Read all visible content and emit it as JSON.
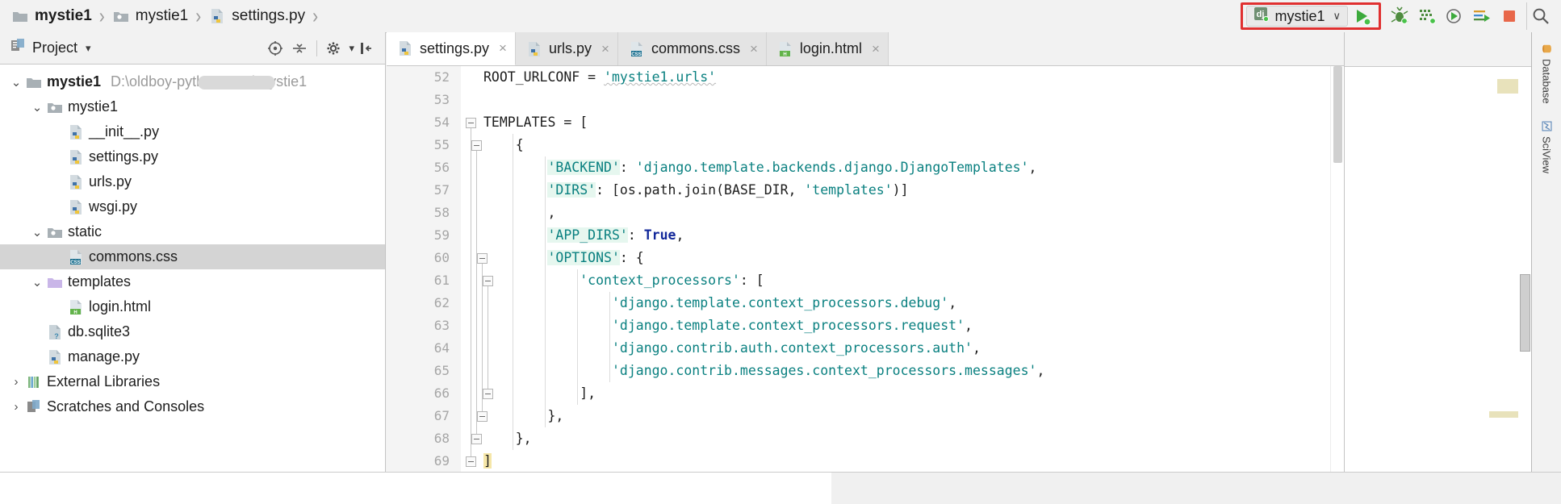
{
  "breadcrumb": {
    "items": [
      {
        "label": "mystie1",
        "icon": "folder-icon",
        "bold": true
      },
      {
        "label": "mystie1",
        "icon": "module-folder-icon",
        "bold": false
      },
      {
        "label": "settings.py",
        "icon": "python-file-icon",
        "bold": false
      }
    ],
    "separator": "›"
  },
  "toolbar": {
    "run_config": {
      "name": "mystie1",
      "icon": "django-icon",
      "chevron": "∨",
      "highlighted": true,
      "highlight_color": "#e03030"
    },
    "buttons": [
      {
        "name": "run-button",
        "icon": "run-icon",
        "color": "#3caa3c"
      },
      {
        "name": "debug-button",
        "icon": "bug-icon",
        "color": "#3f8b3f"
      },
      {
        "name": "coverage-button",
        "icon": "coverage-icon",
        "color": "#3f8b3f"
      },
      {
        "name": "profile-button",
        "icon": "profile-icon",
        "color": "#5a5a5a"
      },
      {
        "name": "run-with-console-button",
        "icon": "console-run-icon",
        "color": "#d89a2a"
      },
      {
        "name": "stop-button",
        "icon": "stop-icon",
        "color": "#e8674a"
      },
      {
        "name": "search-button",
        "icon": "search-icon",
        "color": "#5a5a5a"
      }
    ]
  },
  "project_panel": {
    "title": "Project",
    "chevron": "▾",
    "icon": "project-icon",
    "header_buttons": [
      {
        "name": "locate-button",
        "icon": "target-icon"
      },
      {
        "name": "collapse-all-button",
        "icon": "collapse-all-icon"
      },
      {
        "name": "settings-button",
        "icon": "gear-icon"
      },
      {
        "name": "hide-button",
        "icon": "hide-panel-icon"
      }
    ],
    "tree": [
      {
        "label": "mystie1",
        "path": "D:\\oldboy-python-s          00\\mystie1",
        "icon": "folder-icon",
        "indent": 0,
        "arrow": "⌄",
        "bold": true,
        "selected": false,
        "redacted": true
      },
      {
        "label": "mystie1",
        "path": "",
        "icon": "module-folder-icon",
        "indent": 1,
        "arrow": "⌄",
        "bold": false,
        "selected": false,
        "redacted": false
      },
      {
        "label": "__init__.py",
        "path": "",
        "icon": "python-file-icon",
        "indent": 2,
        "arrow": "",
        "bold": false,
        "selected": false,
        "redacted": false
      },
      {
        "label": "settings.py",
        "path": "",
        "icon": "python-file-icon",
        "indent": 2,
        "arrow": "",
        "bold": false,
        "selected": false,
        "redacted": false
      },
      {
        "label": "urls.py",
        "path": "",
        "icon": "python-file-icon",
        "indent": 2,
        "arrow": "",
        "bold": false,
        "selected": false,
        "redacted": false
      },
      {
        "label": "wsgi.py",
        "path": "",
        "icon": "python-file-icon",
        "indent": 2,
        "arrow": "",
        "bold": false,
        "selected": false,
        "redacted": false
      },
      {
        "label": "static",
        "path": "",
        "icon": "module-folder-icon",
        "indent": 1,
        "arrow": "⌄",
        "bold": false,
        "selected": false,
        "redacted": false
      },
      {
        "label": "commons.css",
        "path": "",
        "icon": "css-file-icon",
        "indent": 2,
        "arrow": "",
        "bold": false,
        "selected": true,
        "redacted": false
      },
      {
        "label": "templates",
        "path": "",
        "icon": "templates-folder-icon",
        "indent": 1,
        "arrow": "⌄",
        "bold": false,
        "selected": false,
        "redacted": false
      },
      {
        "label": "login.html",
        "path": "",
        "icon": "html-file-icon",
        "indent": 2,
        "arrow": "",
        "bold": false,
        "selected": false,
        "redacted": false
      },
      {
        "label": "db.sqlite3",
        "path": "",
        "icon": "unknown-file-icon",
        "indent": 1,
        "arrow": "",
        "bold": false,
        "selected": false,
        "redacted": false
      },
      {
        "label": "manage.py",
        "path": "",
        "icon": "python-file-icon",
        "indent": 1,
        "arrow": "",
        "bold": false,
        "selected": false,
        "redacted": false
      },
      {
        "label": "External Libraries",
        "path": "",
        "icon": "libraries-icon",
        "indent": 0,
        "arrow": "›",
        "bold": false,
        "selected": false,
        "redacted": false
      },
      {
        "label": "Scratches and Consoles",
        "path": "",
        "icon": "scratches-icon",
        "indent": 0,
        "arrow": "›",
        "bold": false,
        "selected": false,
        "redacted": false
      }
    ]
  },
  "editor": {
    "tabs": [
      {
        "label": "settings.py",
        "icon": "python-file-icon",
        "active": true,
        "close": "×"
      },
      {
        "label": "urls.py",
        "icon": "python-file-icon",
        "active": false,
        "close": "×"
      },
      {
        "label": "commons.css",
        "icon": "css-file-icon",
        "active": false,
        "close": "×"
      },
      {
        "label": "login.html",
        "icon": "html-file-icon",
        "active": false,
        "close": "×"
      }
    ],
    "first_line_number": 52,
    "lines": [
      {
        "n": 52,
        "indent": 0,
        "fold": false,
        "tokens": [
          {
            "t": "ROOT_URLCONF = ",
            "c": "plain"
          },
          {
            "t": "'mystie1.urls'",
            "c": "str spell"
          }
        ]
      },
      {
        "n": 53,
        "indent": 0,
        "fold": false,
        "tokens": []
      },
      {
        "n": 54,
        "indent": 0,
        "fold": true,
        "tokens": [
          {
            "t": "TEMPLATES = [",
            "c": "plain"
          }
        ]
      },
      {
        "n": 55,
        "indent": 1,
        "fold": true,
        "tokens": [
          {
            "t": "{",
            "c": "plain"
          }
        ]
      },
      {
        "n": 56,
        "indent": 2,
        "fold": false,
        "tokens": [
          {
            "t": "'BACKEND'",
            "c": "str keyhl"
          },
          {
            "t": ": ",
            "c": "plain"
          },
          {
            "t": "'django.template.backends.django.DjangoTemplates'",
            "c": "str"
          },
          {
            "t": ",",
            "c": "plain"
          }
        ]
      },
      {
        "n": 57,
        "indent": 2,
        "fold": false,
        "tokens": [
          {
            "t": "'DIRS'",
            "c": "str keyhl"
          },
          {
            "t": ": [os.path.join(BASE_DIR, ",
            "c": "plain"
          },
          {
            "t": "'templates'",
            "c": "str"
          },
          {
            "t": ")]",
            "c": "plain"
          }
        ]
      },
      {
        "n": 58,
        "indent": 2,
        "fold": false,
        "tokens": [
          {
            "t": ",",
            "c": "plain"
          }
        ]
      },
      {
        "n": 59,
        "indent": 2,
        "fold": false,
        "tokens": [
          {
            "t": "'APP_DIRS'",
            "c": "str keyhl"
          },
          {
            "t": ": ",
            "c": "plain"
          },
          {
            "t": "True",
            "c": "kw"
          },
          {
            "t": ",",
            "c": "plain"
          }
        ]
      },
      {
        "n": 60,
        "indent": 2,
        "fold": true,
        "tokens": [
          {
            "t": "'OPTIONS'",
            "c": "str keyhl"
          },
          {
            "t": ": {",
            "c": "plain"
          }
        ]
      },
      {
        "n": 61,
        "indent": 3,
        "fold": true,
        "tokens": [
          {
            "t": "'context_processors'",
            "c": "str"
          },
          {
            "t": ": [",
            "c": "plain"
          }
        ]
      },
      {
        "n": 62,
        "indent": 4,
        "fold": false,
        "tokens": [
          {
            "t": "'django.template.context_processors.debug'",
            "c": "str"
          },
          {
            "t": ",",
            "c": "plain"
          }
        ]
      },
      {
        "n": 63,
        "indent": 4,
        "fold": false,
        "tokens": [
          {
            "t": "'django.template.context_processors.request'",
            "c": "str"
          },
          {
            "t": ",",
            "c": "plain"
          }
        ]
      },
      {
        "n": 64,
        "indent": 4,
        "fold": false,
        "tokens": [
          {
            "t": "'django.contrib.auth.context_processors.auth'",
            "c": "str"
          },
          {
            "t": ",",
            "c": "plain"
          }
        ]
      },
      {
        "n": 65,
        "indent": 4,
        "fold": false,
        "tokens": [
          {
            "t": "'django.contrib.messages.context_processors.messages'",
            "c": "str"
          },
          {
            "t": ",",
            "c": "plain"
          }
        ]
      },
      {
        "n": 66,
        "indent": 3,
        "fold": true,
        "tokens": [
          {
            "t": "],",
            "c": "plain"
          }
        ]
      },
      {
        "n": 67,
        "indent": 2,
        "fold": true,
        "tokens": [
          {
            "t": "},",
            "c": "plain"
          }
        ]
      },
      {
        "n": 68,
        "indent": 1,
        "fold": true,
        "tokens": [
          {
            "t": "},",
            "c": "plain"
          }
        ]
      },
      {
        "n": 69,
        "indent": 0,
        "fold": true,
        "tokens": [
          {
            "t": "]",
            "c": "plain brhl"
          }
        ]
      }
    ]
  },
  "tool_strip": {
    "tabs": [
      {
        "label": "Database",
        "icon": "database-icon"
      },
      {
        "label": "SciView",
        "icon": "sciview-icon"
      }
    ]
  }
}
